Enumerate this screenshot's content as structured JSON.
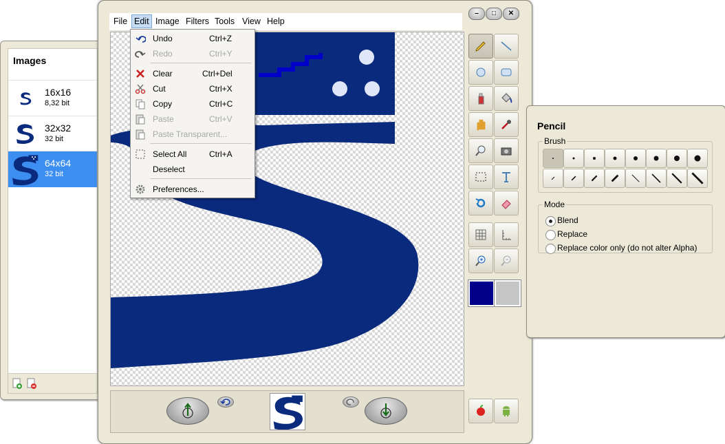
{
  "images_panel": {
    "title": "Images",
    "items": [
      {
        "size": "16x16",
        "depth": "8,32 bit"
      },
      {
        "size": "32x32",
        "depth": "32 bit"
      },
      {
        "size": "64x64",
        "depth": "32 bit"
      }
    ]
  },
  "menubar": [
    "File",
    "Edit",
    "Image",
    "Filters",
    "Tools",
    "View",
    "Help"
  ],
  "window_controls": {
    "minimize": "–",
    "maximize": "□",
    "close": "✕"
  },
  "edit_menu": [
    {
      "label": "Undo",
      "shortcut": "Ctrl+Z"
    },
    {
      "label": "Redo",
      "shortcut": "Ctrl+Y"
    },
    {
      "label": "Clear",
      "shortcut": "Ctrl+Del"
    },
    {
      "label": "Cut",
      "shortcut": "Ctrl+X"
    },
    {
      "label": "Copy",
      "shortcut": "Ctrl+C"
    },
    {
      "label": "Paste",
      "shortcut": "Ctrl+V"
    },
    {
      "label": "Paste Transparent...",
      "shortcut": ""
    },
    {
      "label": "Select All",
      "shortcut": "Ctrl+A"
    },
    {
      "label": "Deselect",
      "shortcut": ""
    },
    {
      "label": "Preferences...",
      "shortcut": ""
    }
  ],
  "colors": {
    "primary": "#00008b",
    "secondary": "#c6c6c6",
    "logo": "#0a2a7e",
    "selection": "#3c8ef0"
  },
  "pencil_panel": {
    "title": "Pencil",
    "brush_label": "Brush",
    "mode_label": "Mode",
    "modes": [
      "Blend",
      "Replace",
      "Replace color only (do not alter Alpha)"
    ],
    "selected_mode": "Blend"
  }
}
